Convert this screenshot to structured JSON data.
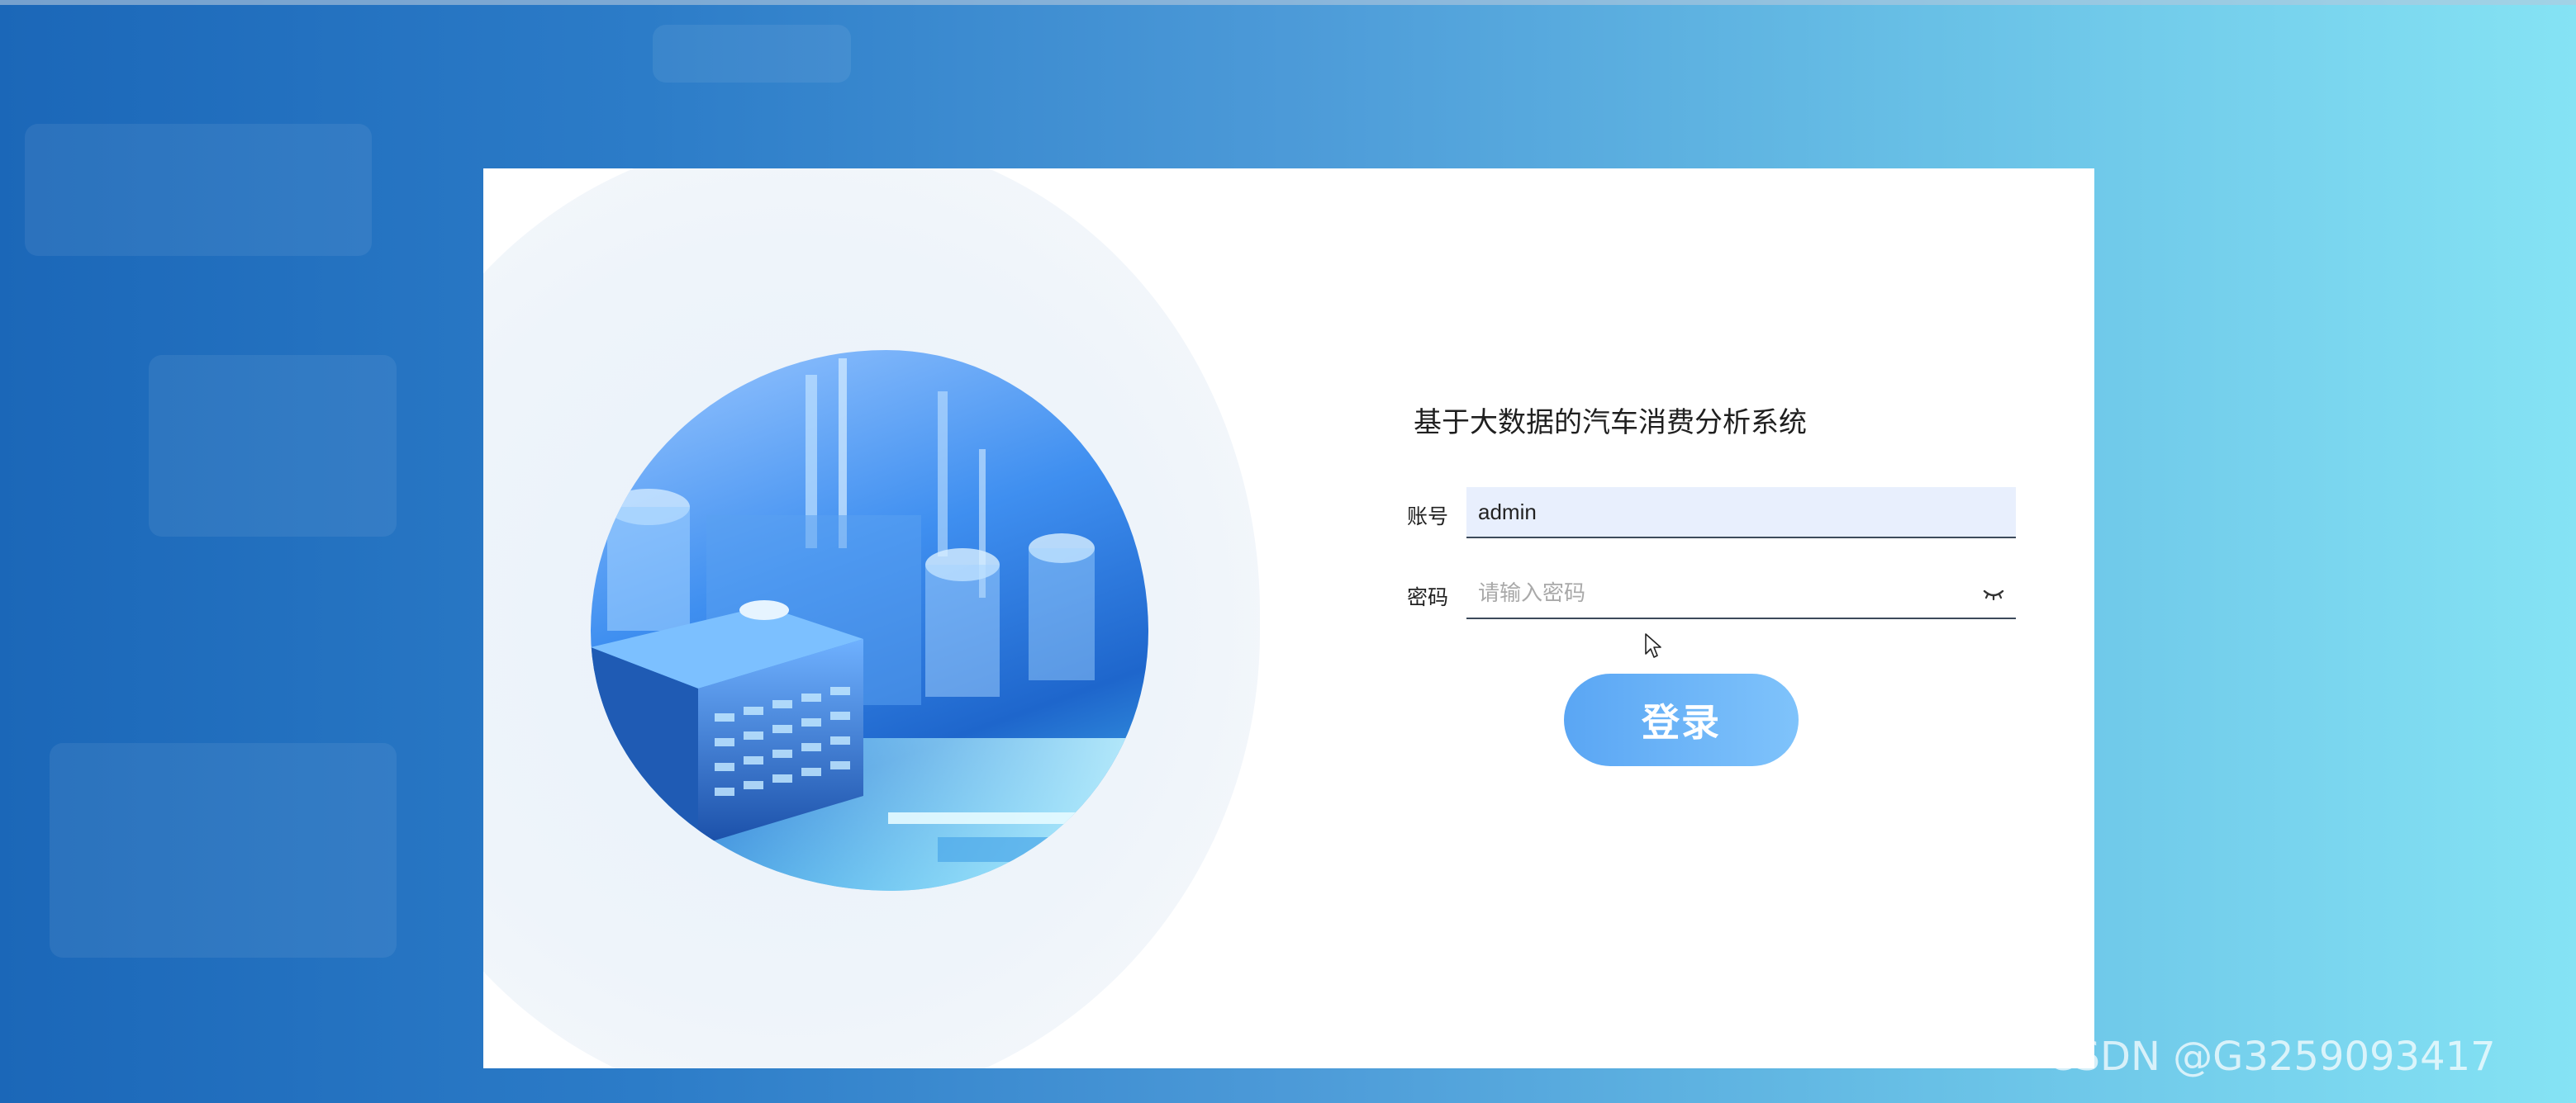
{
  "app": {
    "title": "基于大数据的汽车消费分析系统"
  },
  "login_form": {
    "account_label": "账号",
    "account_value": "admin",
    "password_label": "密码",
    "password_value": "",
    "password_placeholder": "请输入密码",
    "password_toggle_icon": "eye-closed-icon",
    "submit_label": "登录"
  },
  "watermark": {
    "text": "CSDN @G3259093417"
  },
  "colors": {
    "background_left": "#1b67b8",
    "background_right": "#85e3f4",
    "button_start": "#5aa6f4",
    "button_end": "#7fc3fb",
    "account_field_bg": "#e8effd"
  }
}
